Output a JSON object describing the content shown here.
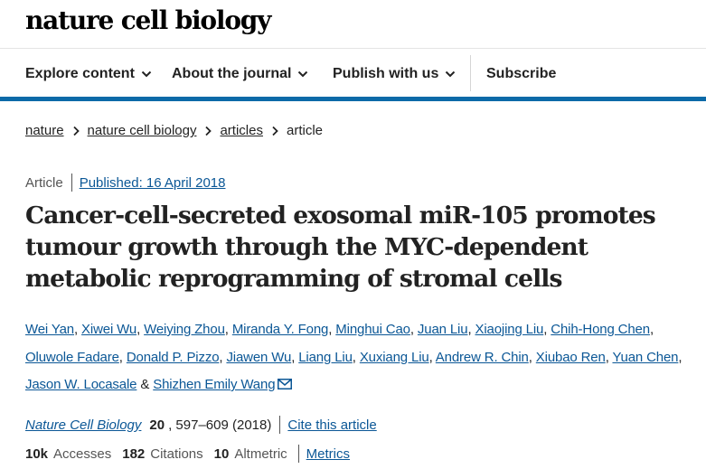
{
  "header": {
    "logo": "nature cell biology",
    "nav": [
      {
        "label": "Explore content",
        "has_dropdown": true
      },
      {
        "label": "About the journal",
        "has_dropdown": true
      },
      {
        "label": "Publish with us",
        "has_dropdown": true
      },
      {
        "label": "Subscribe",
        "has_dropdown": false
      }
    ],
    "accent_color": "#0b6aa8"
  },
  "breadcrumb": [
    "nature",
    "nature cell biology",
    "articles",
    "article"
  ],
  "article": {
    "type": "Article",
    "published": "Published: 16 April 2018",
    "title": "Cancer-cell-secreted exosomal miR-105 promotes tumour growth through the MYC-dependent metabolic reprogramming of stromal cells",
    "authors": [
      "Wei Yan",
      "Xiwei Wu",
      "Weiying Zhou",
      "Miranda Y. Fong",
      "Minghui Cao",
      "Juan Liu",
      "Xiaojing Liu",
      "Chih-Hong Chen",
      "Oluwole Fadare",
      "Donald P. Pizzo",
      "Jiawen Wu",
      "Liang Liu",
      "Xuxiang Liu",
      "Andrew R. Chin",
      "Xiubao Ren",
      "Yuan Chen",
      "Jason W. Locasale",
      "Shizhen Emily Wang"
    ],
    "author_sep": ", ",
    "author_last_sep": " & ",
    "citation": {
      "journal": "Nature Cell Biology",
      "volume": "20",
      "pages": ", 597–609 (2018)",
      "cite_link": "Cite this article"
    },
    "metrics": {
      "accesses_value": "10k",
      "accesses_label": "Accesses",
      "citations_value": "182",
      "citations_label": "Citations",
      "altmetric_value": "10",
      "altmetric_label": "Altmetric",
      "metrics_link": "Metrics"
    }
  }
}
